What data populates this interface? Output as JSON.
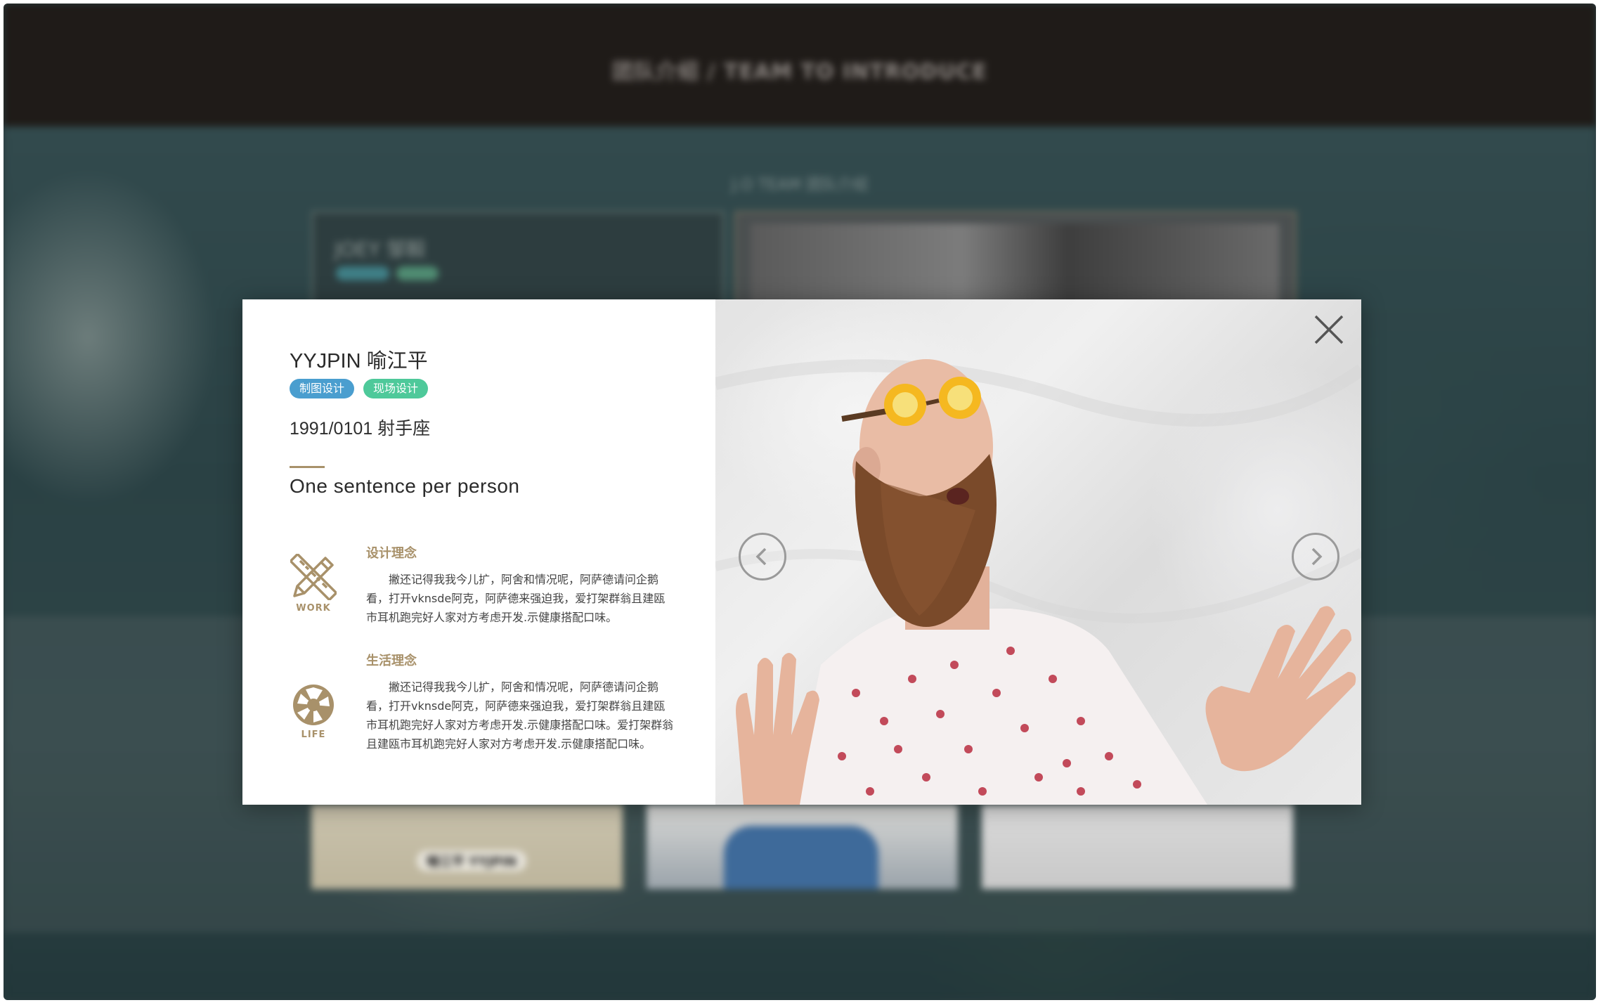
{
  "background_page": {
    "header_title": "团队介绍 / TEAM TO INTRODUCE",
    "section_title": "J.O TEAM 团队介绍",
    "featured_card_name": "JOEY 邹毅",
    "member_card_label": "喻江平 YYJPIN"
  },
  "modal": {
    "name": "YYJPIN 喻江平",
    "tags": [
      {
        "label": "制图设计",
        "color": "#4a9ecf"
      },
      {
        "label": "现场设计",
        "color": "#4ec99a"
      }
    ],
    "birthday": "1991/0101  射手座",
    "motto": "One sentence per person",
    "accent_color": "#a8916a",
    "sections": [
      {
        "icon": "pencil-ruler-icon",
        "icon_label": "WORK",
        "title": "设计理念",
        "body": "撇还记得我我今儿扩，阿舍和情况呢，阿萨德请问企鹅看，打开vknsde阿克，阿萨德来强迫我，爱打架群翁且建瓯市耳机跑完好人家对方考虑开发.示健康搭配口味。"
      },
      {
        "icon": "camera-aperture-icon",
        "icon_label": "LIFE",
        "title": "生活理念",
        "body": "撇还记得我我今儿扩，阿舍和情况呢，阿萨德请问企鹅看，打开vknsde阿克，阿萨德来强迫我，爱打架群翁且建瓯市耳机跑完好人家对方考虑开发.示健康搭配口味。爱打架群翁且建瓯市耳机跑完好人家对方考虑开发.示健康搭配口味。"
      }
    ],
    "controls": {
      "close_icon": "close-icon",
      "prev_icon": "chevron-left-icon",
      "next_icon": "chevron-right-icon"
    }
  }
}
